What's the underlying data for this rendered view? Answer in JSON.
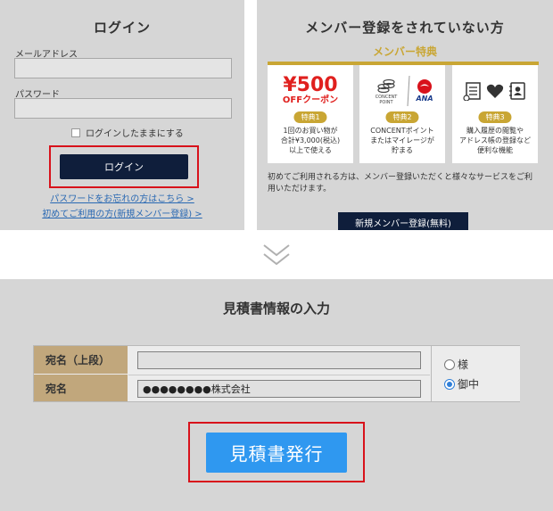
{
  "login": {
    "title": "ログイン",
    "email_label": "メールアドレス",
    "email_value": "",
    "password_label": "パスワード",
    "password_value": "",
    "keep_logged_in_label": "ログインしたままにする",
    "login_button": "ログイン",
    "forgot_password_link": "パスワードをお忘れの方はこちら >",
    "first_time_link": "初めてご利用の方(新規メンバー登録) >"
  },
  "member": {
    "title": "メンバー登録をされていない方",
    "benefit_title": "メンバー特典",
    "benefits": [
      {
        "icon": "coupon-500-icon",
        "coupon_amount": "¥500",
        "coupon_label": "OFFクーポン",
        "badge": "特典1",
        "lines": [
          "1回のお買い物が",
          "合計¥3,000(税込)",
          "以上で使える"
        ]
      },
      {
        "icon": "points-icon",
        "concent_label": "CONCENT POINT",
        "ana_label": "ANA",
        "badge": "特典2",
        "lines": [
          "CONCENTポイント",
          "またはマイレージが",
          "貯まる"
        ]
      },
      {
        "icon": "history-favorite-addressbook-icon",
        "badge": "特典3",
        "lines": [
          "購入履歴の閲覧や",
          "アドレス帳の登録など",
          "便利な機能"
        ]
      }
    ],
    "description": "初めてご利用される方は、メンバー登録いただくと様々なサービスをご利用いただけます。",
    "register_button": "新規メンバー登録(無料)"
  },
  "quote": {
    "title": "見積書情報の入力",
    "rows": [
      {
        "label": "宛名（上段）",
        "value": ""
      },
      {
        "label": "宛名",
        "value": "●●●●●●●●株式会社"
      }
    ],
    "honorifics": [
      {
        "label": "様",
        "selected": false
      },
      {
        "label": "御中",
        "selected": true
      }
    ],
    "issue_button": "見積書発行"
  },
  "colors": {
    "navy": "#0f1e3b",
    "gold": "#c9a634",
    "highlight_red": "#d8121b",
    "action_blue": "#2f98f0",
    "link_blue": "#2a69b3"
  }
}
